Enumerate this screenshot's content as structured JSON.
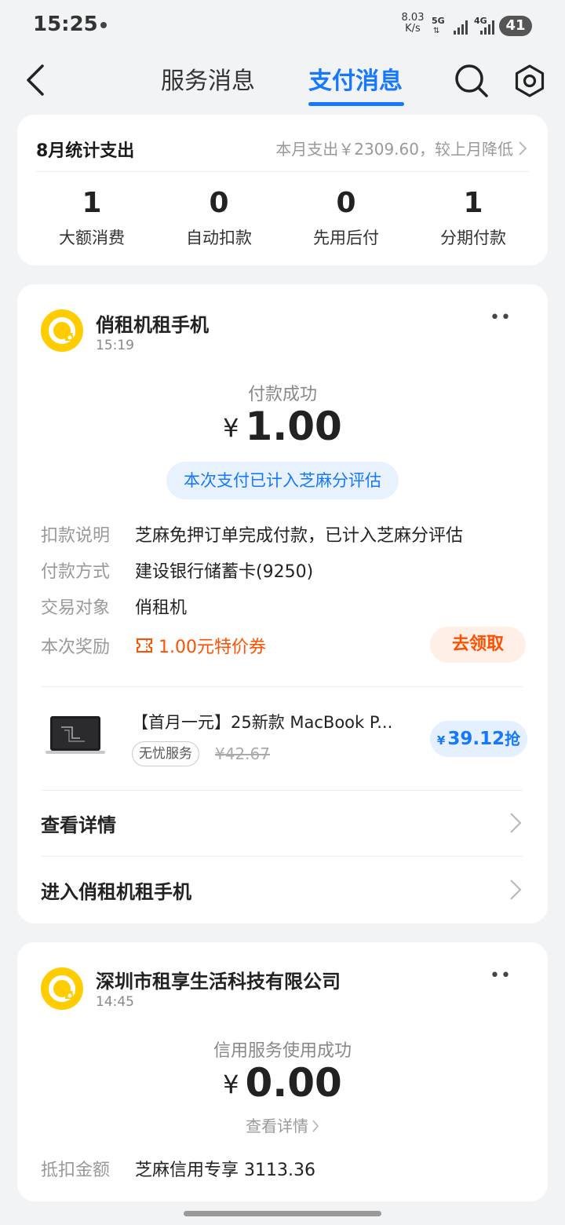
{
  "status_bar": {
    "time": "15:25",
    "net_speed_value": "8.03",
    "net_speed_unit": "K/s",
    "sim1_label": "5G",
    "sim2_label": "4G",
    "battery": "41"
  },
  "nav": {
    "tabs": [
      {
        "label": "服务消息",
        "active": false
      },
      {
        "label": "支付消息",
        "active": true
      }
    ],
    "accent_color": "#1677ff"
  },
  "summary": {
    "title": "8月统计支出",
    "detail": "本月支出￥2309.60，较上月降低",
    "stats": [
      {
        "value": "1",
        "label": "大额消费"
      },
      {
        "value": "0",
        "label": "自动扣款"
      },
      {
        "value": "0",
        "label": "先用后付"
      },
      {
        "value": "1",
        "label": "分期付款"
      }
    ]
  },
  "messages": [
    {
      "merchant": "俏租机租手机",
      "time": "15:19",
      "status": "付款成功",
      "currency": "¥",
      "amount": "1.00",
      "zhima_note": "本次支付已计入芝麻分评估",
      "details": [
        {
          "key": "扣款说明",
          "value": "芝麻免押订单完成付款，已计入芝麻分评估"
        },
        {
          "key": "付款方式",
          "value": "建设银行储蓄卡(9250)"
        },
        {
          "key": "交易对象",
          "value": "俏租机"
        }
      ],
      "reward": {
        "key": "本次奖励",
        "coupon": "1.00元特价券",
        "claim_label": "去领取"
      },
      "product": {
        "title": "【首月一元】25新款 MacBook P...",
        "tag": "无忧服务",
        "old_price": "¥42.67",
        "currency": "¥",
        "price": "39.12",
        "action": "抢"
      },
      "links": [
        {
          "label": "查看详情"
        },
        {
          "label": "进入俏租机租手机"
        }
      ]
    },
    {
      "merchant": "深圳市租享生活科技有限公司",
      "time": "14:45",
      "status": "信用服务使用成功",
      "currency": "¥",
      "amount": "0.00",
      "view_detail": "查看详情",
      "details": [
        {
          "key": "抵扣金额",
          "value": "芝麻信用专享 3113.36"
        }
      ]
    }
  ]
}
